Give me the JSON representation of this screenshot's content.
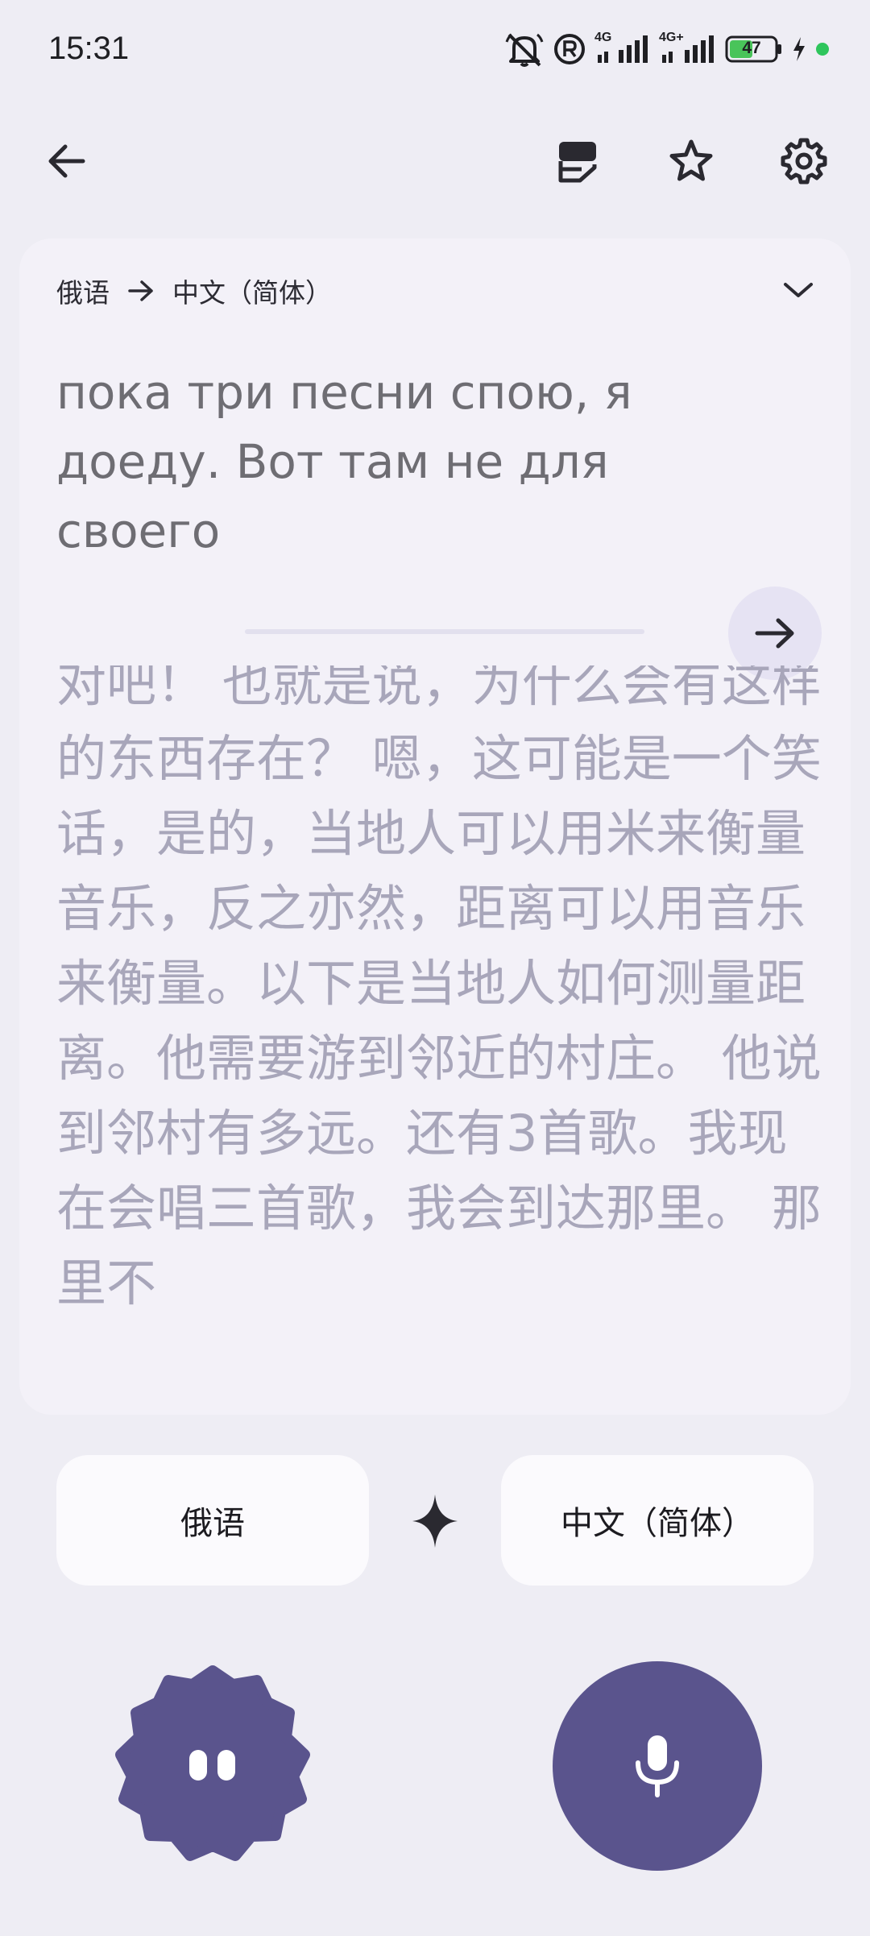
{
  "status_bar": {
    "time": "15:31",
    "network_1": "4G",
    "network_2": "4G+",
    "battery": "47"
  },
  "toolbar": {
    "back_icon": "arrow-back-icon",
    "icons": [
      "transcript-icon",
      "star-icon",
      "gear-icon"
    ]
  },
  "card": {
    "source_lang": "俄语",
    "target_lang": "中文（简体）",
    "source_text": "пока три песни спою, я доеду. Вот там не для своего",
    "translation_text": "对吧！ 也就是说，为什么会有这样的东西存在？ 嗯，这可能是一个笑话，是的，当地人可以用米来衡量音乐，反之亦然，距离可以用音乐来衡量。以下是当地人如何测量距离。他需要游到邻近的村庄。 他说到邻村有多远。还有3首歌。我现在会唱三首歌，我会到达那里。 那里不"
  },
  "lang_buttons": {
    "left": "俄语",
    "right": "中文（简体）"
  },
  "colors": {
    "background": "#EEEDF4",
    "accent": "#5A548D",
    "translation_text": "#A8A6BA"
  }
}
